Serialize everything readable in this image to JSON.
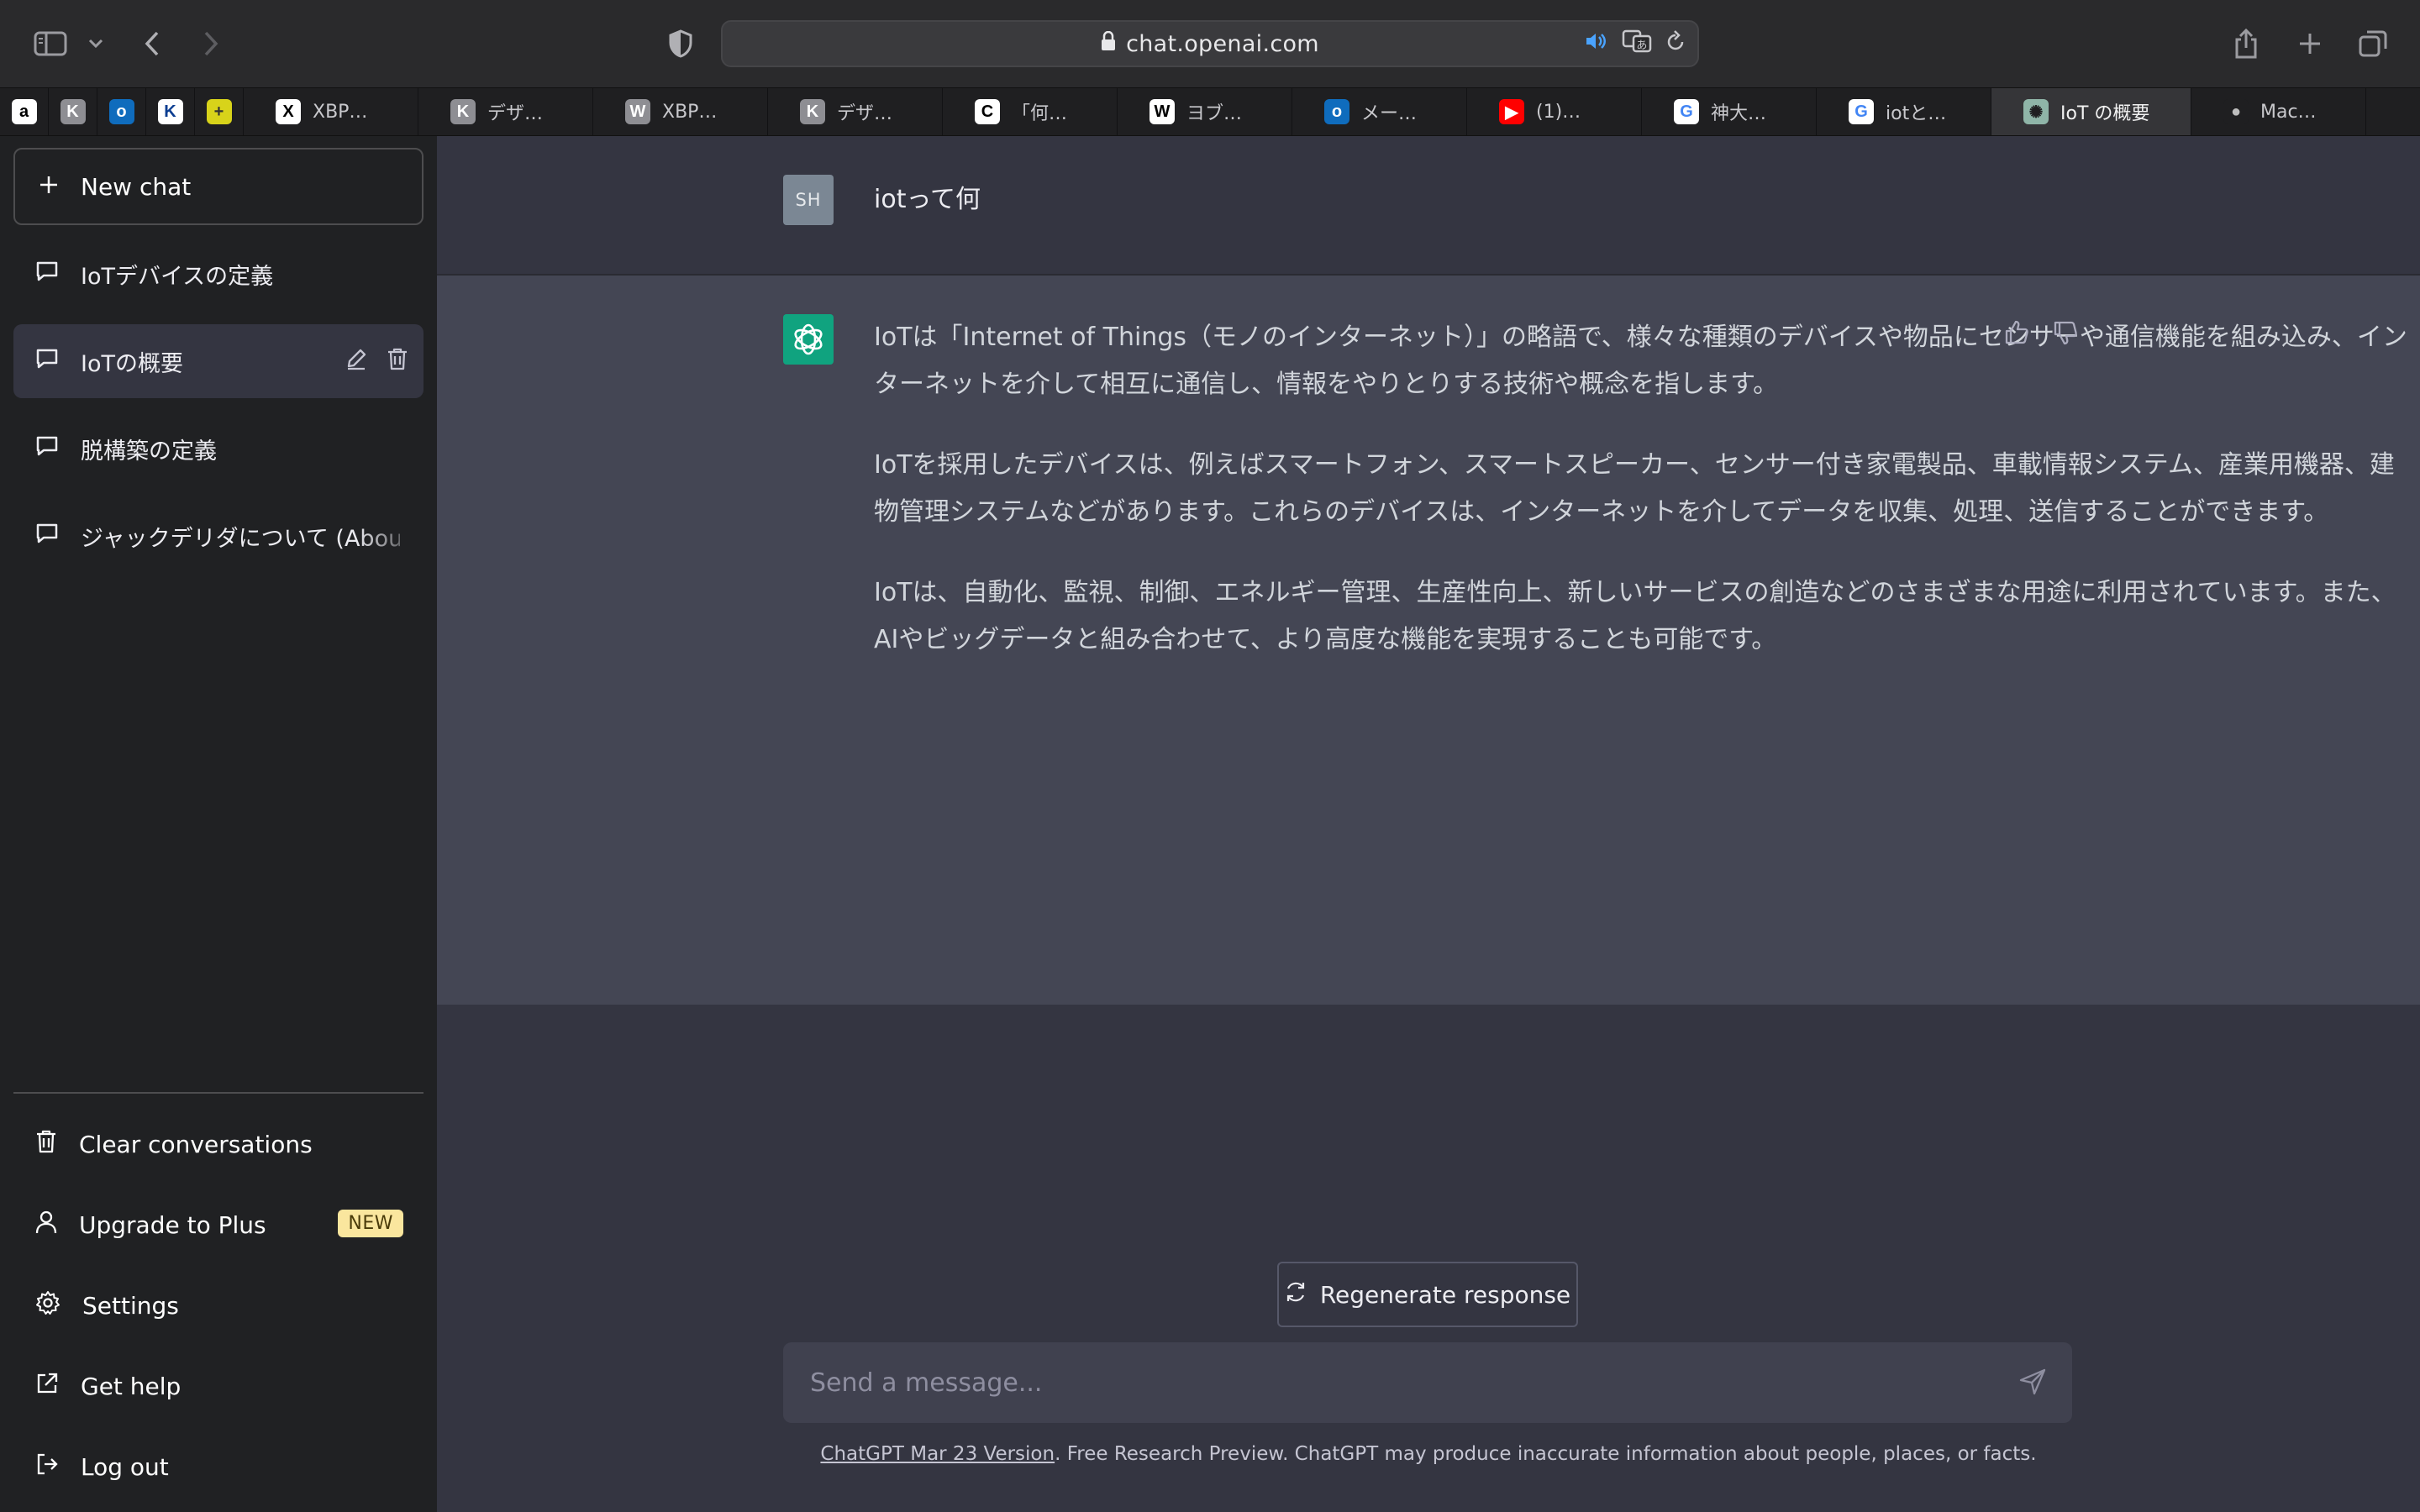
{
  "browser": {
    "url": "chat.openai.com",
    "pinned_tabs": [
      {
        "icon": "amazon-icon",
        "glyph": "a",
        "color": "#ffffff",
        "fg": "#000000"
      },
      {
        "icon": "k-icon",
        "glyph": "K",
        "color": "#8e8e93",
        "fg": "#ffffff"
      },
      {
        "icon": "outlook-icon",
        "glyph": "o",
        "color": "#0f6cbd",
        "fg": "#ffffff"
      },
      {
        "icon": "ku-icon",
        "glyph": "K",
        "color": "#ffffff",
        "fg": "#0b3d91"
      },
      {
        "icon": "yellow-badge-icon",
        "glyph": "+",
        "color": "#d8d31a",
        "fg": "#333333"
      }
    ],
    "tabs": [
      {
        "icon": "x-icon",
        "glyph": "X",
        "color": "#ffffff",
        "fg": "#000000",
        "label": "XBP…"
      },
      {
        "icon": "k-icon",
        "glyph": "K",
        "color": "#8e8e93",
        "fg": "#ffffff",
        "label": "デザ…"
      },
      {
        "icon": "w-icon",
        "glyph": "W",
        "color": "#8e8e93",
        "fg": "#ffffff",
        "label": "XBP…"
      },
      {
        "icon": "k-icon",
        "glyph": "K",
        "color": "#8e8e93",
        "fg": "#ffffff",
        "label": "デザ…"
      },
      {
        "icon": "c-icon",
        "glyph": "C",
        "color": "#ffffff",
        "fg": "#000000",
        "label": "「何…"
      },
      {
        "icon": "wikipedia-icon",
        "glyph": "W",
        "color": "#ffffff",
        "fg": "#000000",
        "label": "ヨブ…"
      },
      {
        "icon": "outlook-icon",
        "glyph": "o",
        "color": "#0f6cbd",
        "fg": "#ffffff",
        "label": "メー…"
      },
      {
        "icon": "youtube-icon",
        "glyph": "▶",
        "color": "#ff0000",
        "fg": "#ffffff",
        "label": "(1)…"
      },
      {
        "icon": "google-icon",
        "glyph": "G",
        "color": "#ffffff",
        "fg": "#4285f4",
        "label": "神大…"
      },
      {
        "icon": "google-icon",
        "glyph": "G",
        "color": "#ffffff",
        "fg": "#4285f4",
        "label": "iotと…"
      },
      {
        "icon": "chatgpt-icon",
        "glyph": "✺",
        "color": "#8fb5a8",
        "fg": "#1f1f21",
        "label": "IoT の概要",
        "active": true
      },
      {
        "icon": "apple-icon",
        "glyph": "●",
        "color": "#1f1f21",
        "fg": "#bdbdbd",
        "label": "Mac…"
      }
    ]
  },
  "sidebar": {
    "new_chat": "New chat",
    "history": [
      {
        "label": "IoTデバイスの定義"
      },
      {
        "label": "IoTの概要",
        "active": true
      },
      {
        "label": "脱構築の定義"
      },
      {
        "label": "ジャックデリダについて (About"
      }
    ],
    "bottom": {
      "clear": "Clear conversations",
      "upgrade": "Upgrade to Plus",
      "upgrade_badge": "NEW",
      "settings": "Settings",
      "help": "Get help",
      "logout": "Log out"
    }
  },
  "conversation": {
    "user_avatar": "SH",
    "user_message": "iotって何",
    "assistant_paragraphs": [
      "IoTは「Internet of Things（モノのインターネット）」の略語で、様々な種類のデバイスや物品にセンサーや通信機能を組み込み、インターネットを介して相互に通信し、情報をやりとりする技術や概念を指します。",
      "IoTを採用したデバイスは、例えばスマートフォン、スマートスピーカー、センサー付き家電製品、車載情報システム、産業用機器、建物管理システムなどがあります。これらのデバイスは、インターネットを介してデータを収集、処理、送信することができます。",
      "IoTは、自動化、監視、制御、エネルギー管理、生産性向上、新しいサービスの創造などのさまざまな用途に利用されています。また、AIやビッグデータと組み合わせて、より高度な機能を実現することも可能です。"
    ]
  },
  "composer": {
    "regenerate": "Regenerate response",
    "placeholder": "Send a message..."
  },
  "footer": {
    "version_link": "ChatGPT Mar 23 Version",
    "disclaimer": ". Free Research Preview. ChatGPT may produce inaccurate information about people, places, or facts."
  },
  "colors": {
    "sidebar_bg": "#202123",
    "main_bg": "#343541",
    "assistant_bg": "#444654",
    "brand": "#10a37f",
    "badge": "#fae69e"
  }
}
